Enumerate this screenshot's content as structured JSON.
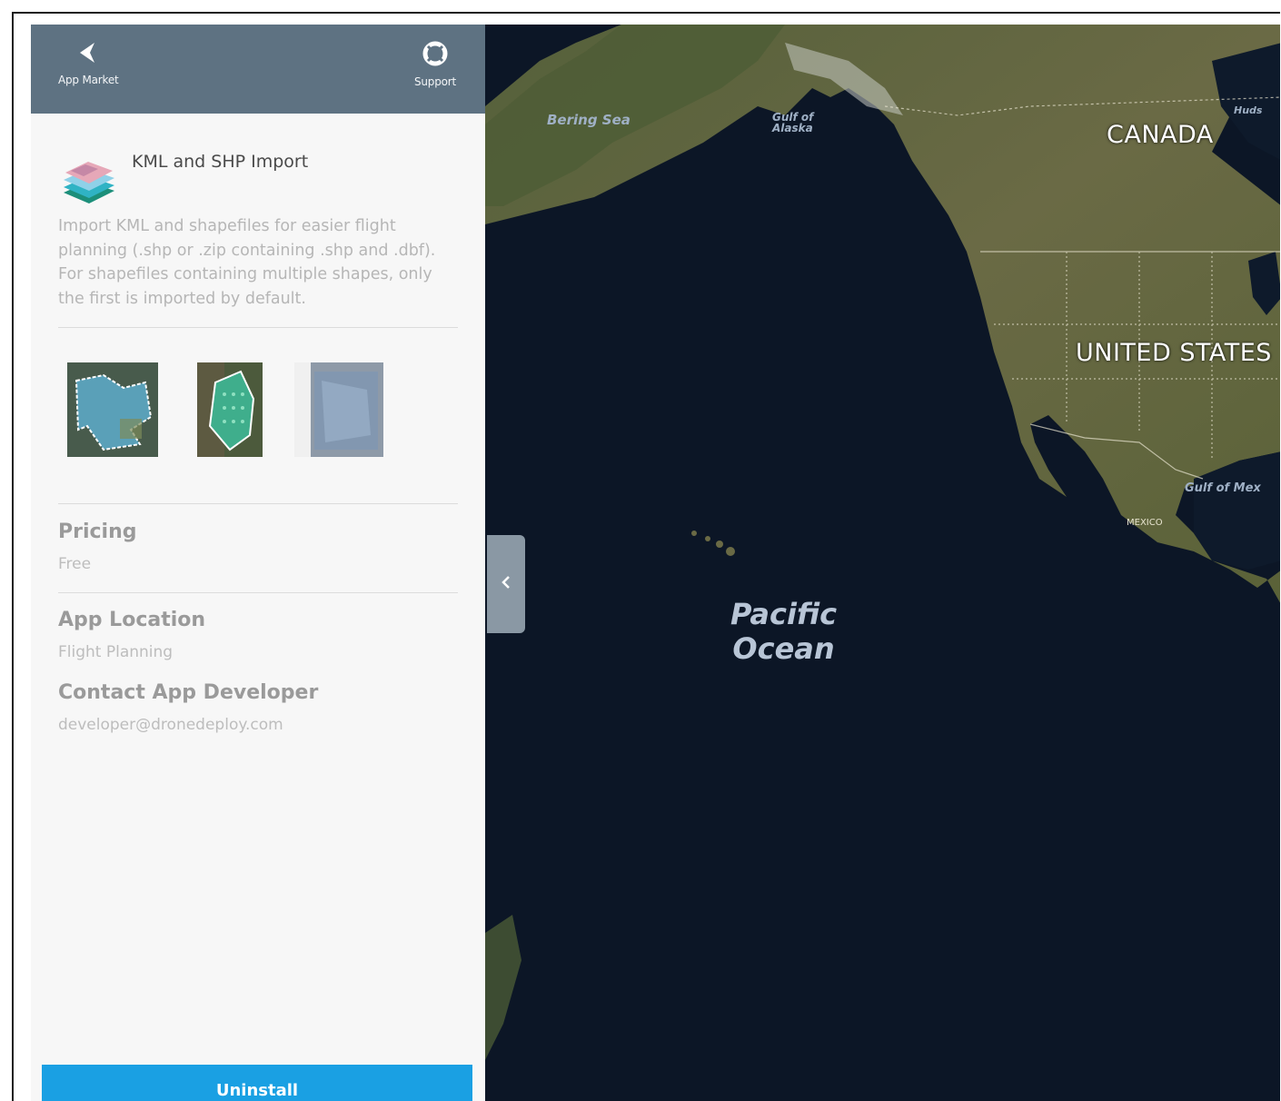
{
  "topbar": {
    "back_label": "App Market",
    "support_label": "Support"
  },
  "app": {
    "title": "KML and SHP Import",
    "description": "Import KML and shapefiles for easier flight planning (.shp or .zip containing .shp and .dbf). For shapefiles containing multiple shapes, only the first is imported by default."
  },
  "details": {
    "pricing_title": "Pricing",
    "pricing_value": "Free",
    "location_title": "App Location",
    "location_value": "Flight Planning",
    "contact_title": "Contact App Developer",
    "contact_value": "developer@dronedeploy.com"
  },
  "actions": {
    "uninstall_label": "Uninstall"
  },
  "map": {
    "ocean_line1": "Pacific",
    "ocean_line2": "Ocean",
    "bering_sea": "Bering Sea",
    "gulf_alaska_1": "Gulf of",
    "gulf_alaska_2": "Alaska",
    "canada": "CANADA",
    "united_states": "UNITED STATES",
    "gulf_mexico": "Gulf of Mex",
    "mexico": "MEXICO",
    "hudson": "Huds"
  },
  "colors": {
    "topbar": "#5e7282",
    "accent": "#1aa0e3",
    "ocean": "#0c1626",
    "land": "#4f5a33"
  }
}
